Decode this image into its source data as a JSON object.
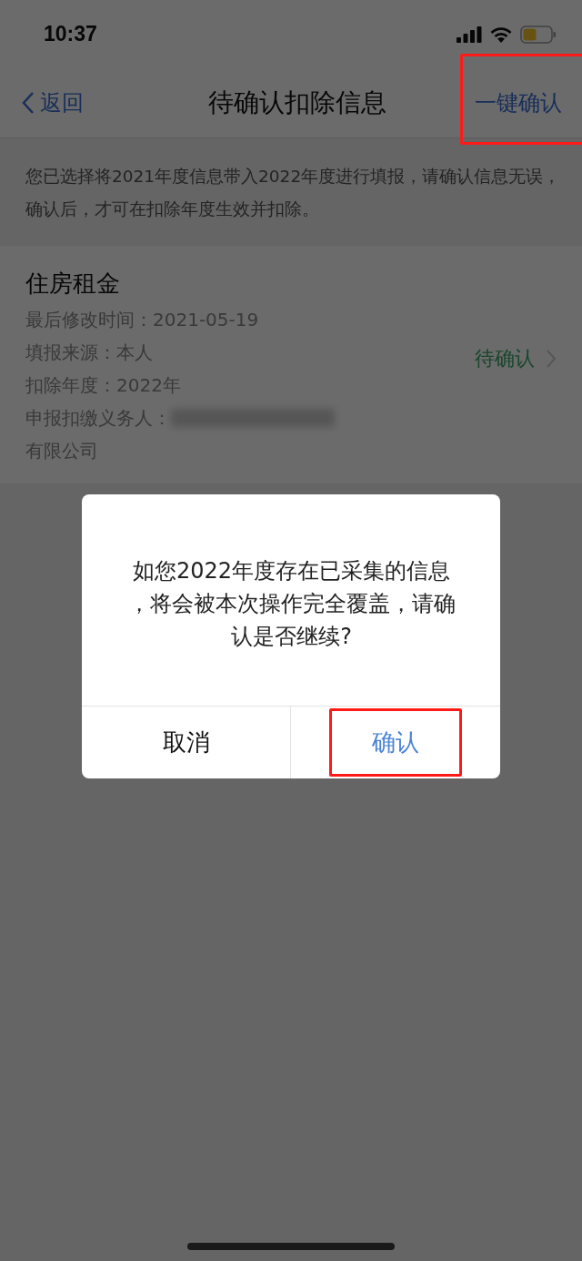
{
  "status_bar": {
    "time": "10:37"
  },
  "nav": {
    "back": "返回",
    "title": "待确认扣除信息",
    "action": {
      "label": "一键确认",
      "highlighted": true
    }
  },
  "notice": "您已选择将2021年度信息带入2022年度进行填报，请确认信息无误，确认后，才可在扣除年度生效并扣除。",
  "card": {
    "title": "住房租金",
    "lines": [
      {
        "label": "最后修改时间：",
        "value": "2021-05-19",
        "kind": "text"
      },
      {
        "label": "填报来源：",
        "value": "本人",
        "kind": "text"
      },
      {
        "label": "扣除年度：",
        "value": "2022年",
        "kind": "text"
      },
      {
        "label": "申报扣缴义务人：",
        "kind": "redacted"
      }
    ],
    "continuation": "有限公司",
    "status": "待确认"
  },
  "dialog": {
    "message": "如您2022年度存在已采集的信息，将会被本次操作完全覆盖，请确认是否继续?",
    "buttons": [
      {
        "label": "取消",
        "kind": "cancel",
        "highlighted": false
      },
      {
        "label": "确认",
        "kind": "primary",
        "highlighted": true
      }
    ]
  }
}
